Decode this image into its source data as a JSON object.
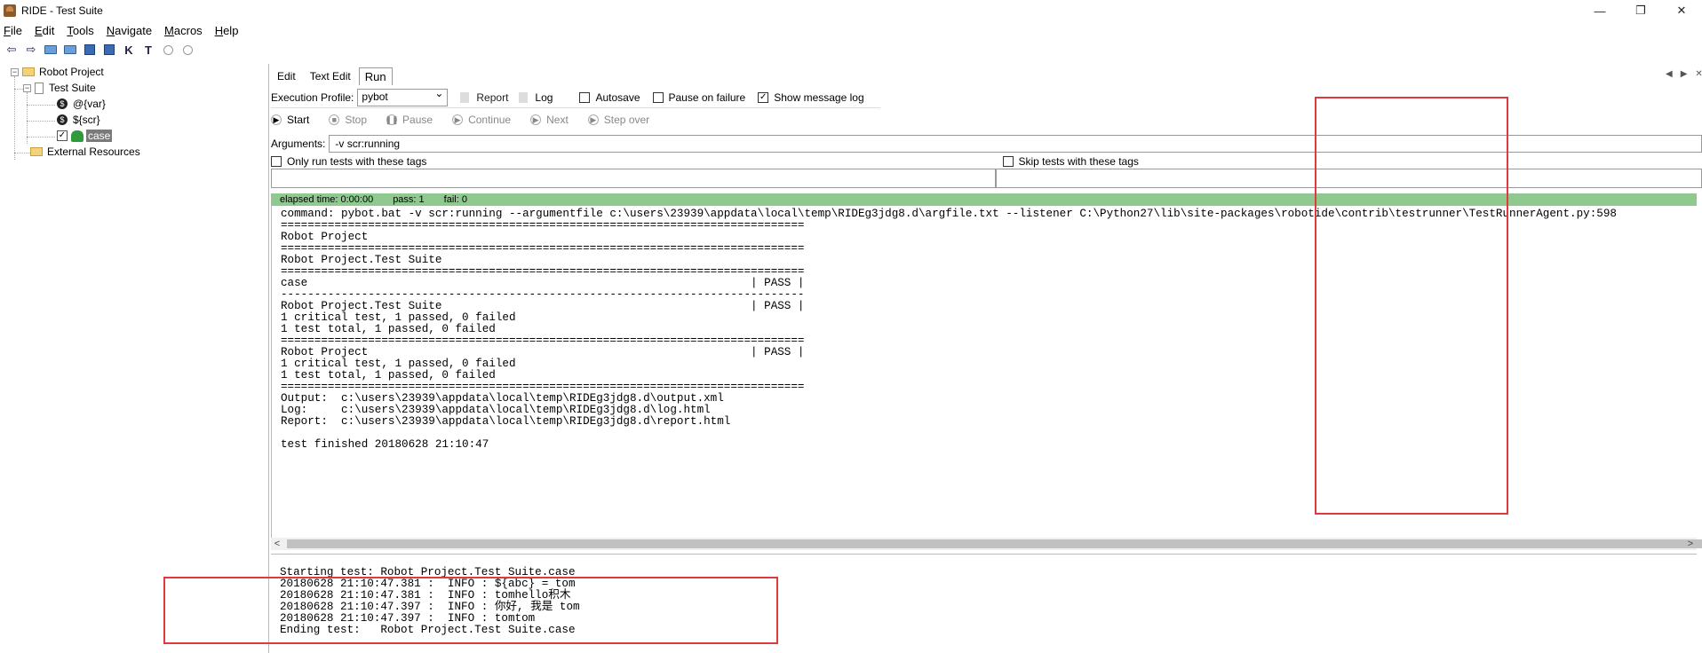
{
  "window": {
    "title": "RIDE - Test Suite",
    "minimize": "—",
    "maximize": "❐",
    "close": "✕"
  },
  "menu": {
    "items": [
      {
        "prefix": "",
        "ul": "F",
        "rest": "ile"
      },
      {
        "prefix": "",
        "ul": "E",
        "rest": "dit"
      },
      {
        "prefix": "",
        "ul": "T",
        "rest": "ools"
      },
      {
        "prefix": "",
        "ul": "N",
        "rest": "avigate"
      },
      {
        "prefix": "",
        "ul": "M",
        "rest": "acros"
      },
      {
        "prefix": "",
        "ul": "H",
        "rest": "elp"
      }
    ]
  },
  "toolbar": {
    "back": "⇦",
    "forward": "⇨",
    "keyword_k": "K",
    "keyword_t": "T"
  },
  "tree": {
    "project": "Robot Project",
    "suite": "Test Suite",
    "var1": "@{var}",
    "var2": "${scr}",
    "case": "case",
    "external": "External Resources",
    "var_glyph": "$",
    "check_glyph": "✓",
    "minus": "−"
  },
  "tabs": [
    {
      "label": "Edit"
    },
    {
      "label": "Text Edit"
    },
    {
      "label": "Run"
    }
  ],
  "tab_nav": {
    "left": "◀",
    "right": "▶",
    "close": "✕"
  },
  "run": {
    "execution_profile_label": "Execution Profile:",
    "profile": "pybot",
    "report_label": "Report",
    "log_label": "Log",
    "autosave_label": "Autosave",
    "pause_on_failure_label": "Pause on failure",
    "show_message_log_label": "Show message log",
    "checked_glyph": "✓",
    "start": "Start",
    "stop": "Stop",
    "pause": "Pause",
    "continue": "Continue",
    "next": "Next",
    "step_over": "Step over",
    "play_glyph": "▶",
    "stop_glyph": "■",
    "pause_glyph": "❚❚",
    "arguments_label": "Arguments:",
    "arguments_value": "-v scr:running",
    "only_run_tags_label": "Only run tests with these tags",
    "skip_tags_label": "Skip tests with these tags"
  },
  "status": {
    "elapsed": "elapsed time: 0:00:00",
    "pass": "pass: 1",
    "fail": "fail: 0"
  },
  "output": {
    "lines": [
      "command: pybot.bat -v scr:running --argumentfile c:\\users\\23939\\appdata\\local\\temp\\RIDEg3jdg8.d\\argfile.txt --listener C:\\Python27\\lib\\site-packages\\robotide\\contrib\\testrunner\\TestRunnerAgent.py:598",
      "==============================================================================",
      "Robot Project",
      "==============================================================================",
      "Robot Project.Test Suite",
      "==============================================================================",
      "case                                                                  | PASS |",
      "------------------------------------------------------------------------------",
      "Robot Project.Test Suite                                              | PASS |",
      "1 critical test, 1 passed, 0 failed",
      "1 test total, 1 passed, 0 failed",
      "==============================================================================",
      "Robot Project                                                         | PASS |",
      "1 critical test, 1 passed, 0 failed",
      "1 test total, 1 passed, 0 failed",
      "==============================================================================",
      "Output:  c:\\users\\23939\\appdata\\local\\temp\\RIDEg3jdg8.d\\output.xml",
      "Log:     c:\\users\\23939\\appdata\\local\\temp\\RIDEg3jdg8.d\\log.html",
      "Report:  c:\\users\\23939\\appdata\\local\\temp\\RIDEg3jdg8.d\\report.html",
      "",
      "test finished 20180628 21:10:47"
    ]
  },
  "scroll": {
    "left": "<",
    "right": ">"
  },
  "message_log": {
    "lines": [
      "Starting test: Robot Project.Test Suite.case",
      "20180628 21:10:47.381 :  INFO : ${abc} = tom",
      "20180628 21:10:47.381 :  INFO : tomhello积木",
      "20180628 21:10:47.397 :  INFO : 你好, 我是 tom",
      "20180628 21:10:47.397 :  INFO : tomtom",
      "Ending test:   Robot Project.Test Suite.case"
    ]
  },
  "colors": {
    "status_bar": "#8fc98f",
    "annotation": "#e0393e"
  }
}
